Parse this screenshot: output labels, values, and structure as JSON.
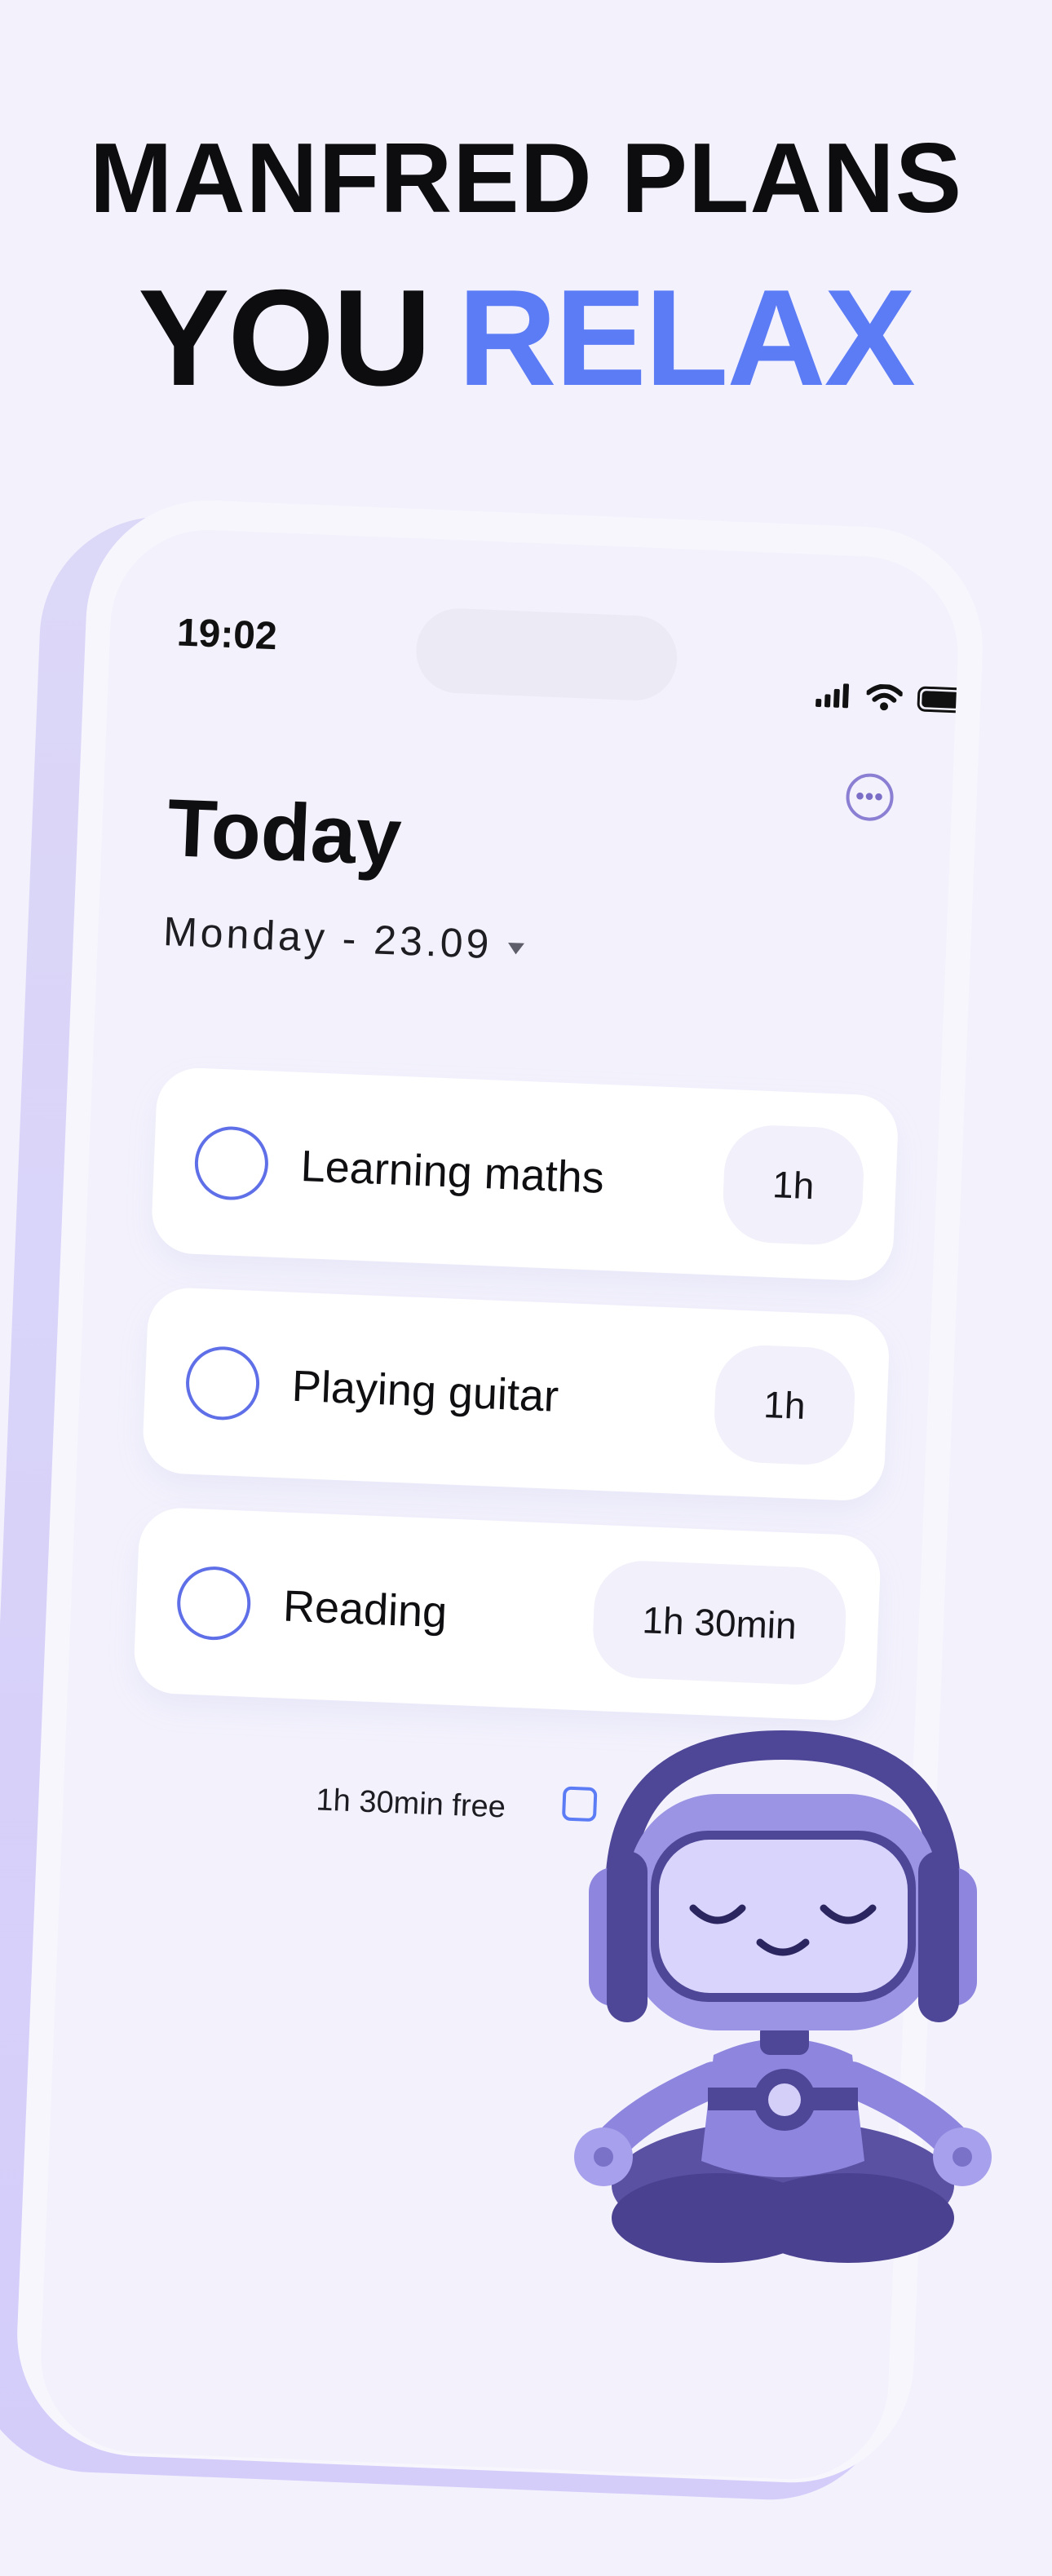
{
  "headline": {
    "line1": "MANFRED PLANS",
    "line2_a": "YOU",
    "line2_b": "RELAX"
  },
  "colors": {
    "accent": "#5c7cf6",
    "robot": "#8e86de",
    "background": "#f3f1fc"
  },
  "status_bar": {
    "time": "19:02",
    "icons": [
      "signal-icon",
      "wifi-icon",
      "battery-icon"
    ]
  },
  "header": {
    "more_icon": "more-icon",
    "more_label": "•••",
    "title": "Today",
    "date": "Monday - 23.09"
  },
  "tasks": [
    {
      "name": "Learning maths",
      "duration": "1h"
    },
    {
      "name": "Playing guitar",
      "duration": "1h"
    },
    {
      "name": "Reading",
      "duration": "1h 30min"
    }
  ],
  "footer": {
    "free_time": "1h 30min free"
  },
  "illustration": "meditating-robot-with-headphones"
}
